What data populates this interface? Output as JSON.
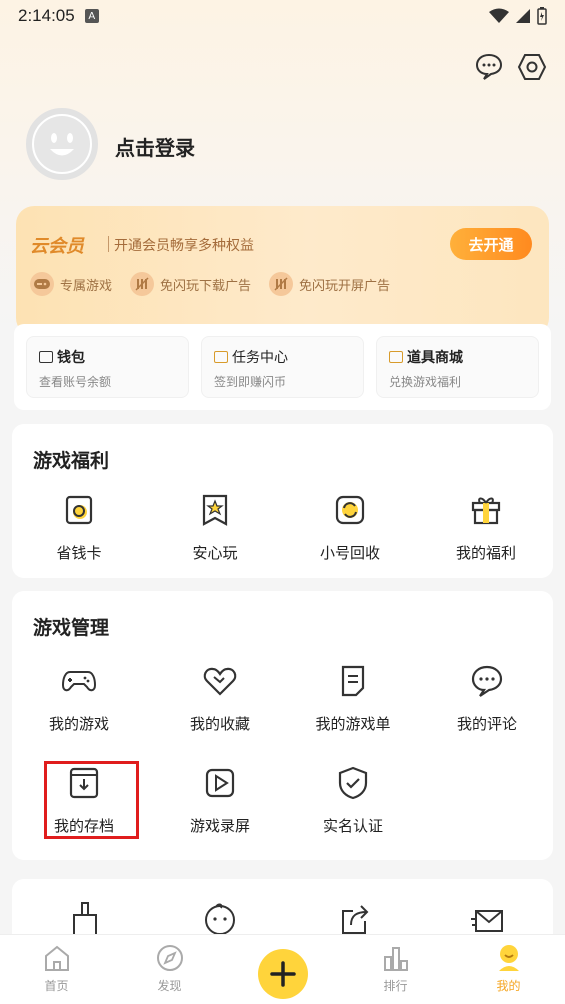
{
  "status_bar": {
    "time": "2:14:05",
    "a_badge": "A"
  },
  "header": {
    "message_icon": "message-icon",
    "settings_icon": "settings-icon"
  },
  "profile": {
    "login_text": "点击登录"
  },
  "vip": {
    "title": "云会员",
    "description": "开通会员畅享多种权益",
    "button": "去开通",
    "perks": [
      {
        "label": "专属游戏",
        "icon": "game-pad-icon"
      },
      {
        "label": "免闪玩下载广告",
        "icon": "no-ad-icon"
      },
      {
        "label": "免闪玩开屏广告",
        "icon": "no-ad-icon"
      }
    ]
  },
  "wallet": {
    "items": [
      {
        "title": "钱包",
        "subtitle": "查看账号余额",
        "icon": "wallet-icon"
      },
      {
        "title": "任务中心",
        "subtitle": "签到即赚闪币",
        "icon": "task-icon"
      },
      {
        "title": "道具商城",
        "subtitle": "兑换游戏福利",
        "icon": "shop-icon"
      }
    ]
  },
  "game_benefits": {
    "title": "游戏福利",
    "items": [
      {
        "label": "省钱卡",
        "icon": "saving-card-icon"
      },
      {
        "label": "安心玩",
        "icon": "safe-play-icon"
      },
      {
        "label": "小号回收",
        "icon": "recycle-icon"
      },
      {
        "label": "我的福利",
        "icon": "gift-icon"
      }
    ]
  },
  "game_management": {
    "title": "游戏管理",
    "items": [
      {
        "label": "我的游戏",
        "icon": "gamepad-icon"
      },
      {
        "label": "我的收藏",
        "icon": "heart-icon"
      },
      {
        "label": "我的游戏单",
        "icon": "list-icon"
      },
      {
        "label": "我的评论",
        "icon": "comment-icon"
      },
      {
        "label": "我的存档",
        "icon": "archive-icon"
      },
      {
        "label": "游戏录屏",
        "icon": "record-icon"
      },
      {
        "label": "实名认证",
        "icon": "shield-icon"
      }
    ]
  },
  "more_icons": [
    "broom-icon",
    "baby-face-icon",
    "share-icon",
    "mail-icon"
  ],
  "bottom_nav": {
    "items": [
      {
        "label": "首页",
        "icon": "home-icon"
      },
      {
        "label": "发现",
        "icon": "compass-icon"
      },
      {
        "label": "",
        "icon": "plus-icon"
      },
      {
        "label": "排行",
        "icon": "ranking-icon"
      },
      {
        "label": "我的",
        "icon": "profile-icon"
      }
    ],
    "active_index": 4
  },
  "colors": {
    "accent": "#f5a623",
    "highlight": "#e01d1d",
    "plus": "#ffd43b"
  }
}
